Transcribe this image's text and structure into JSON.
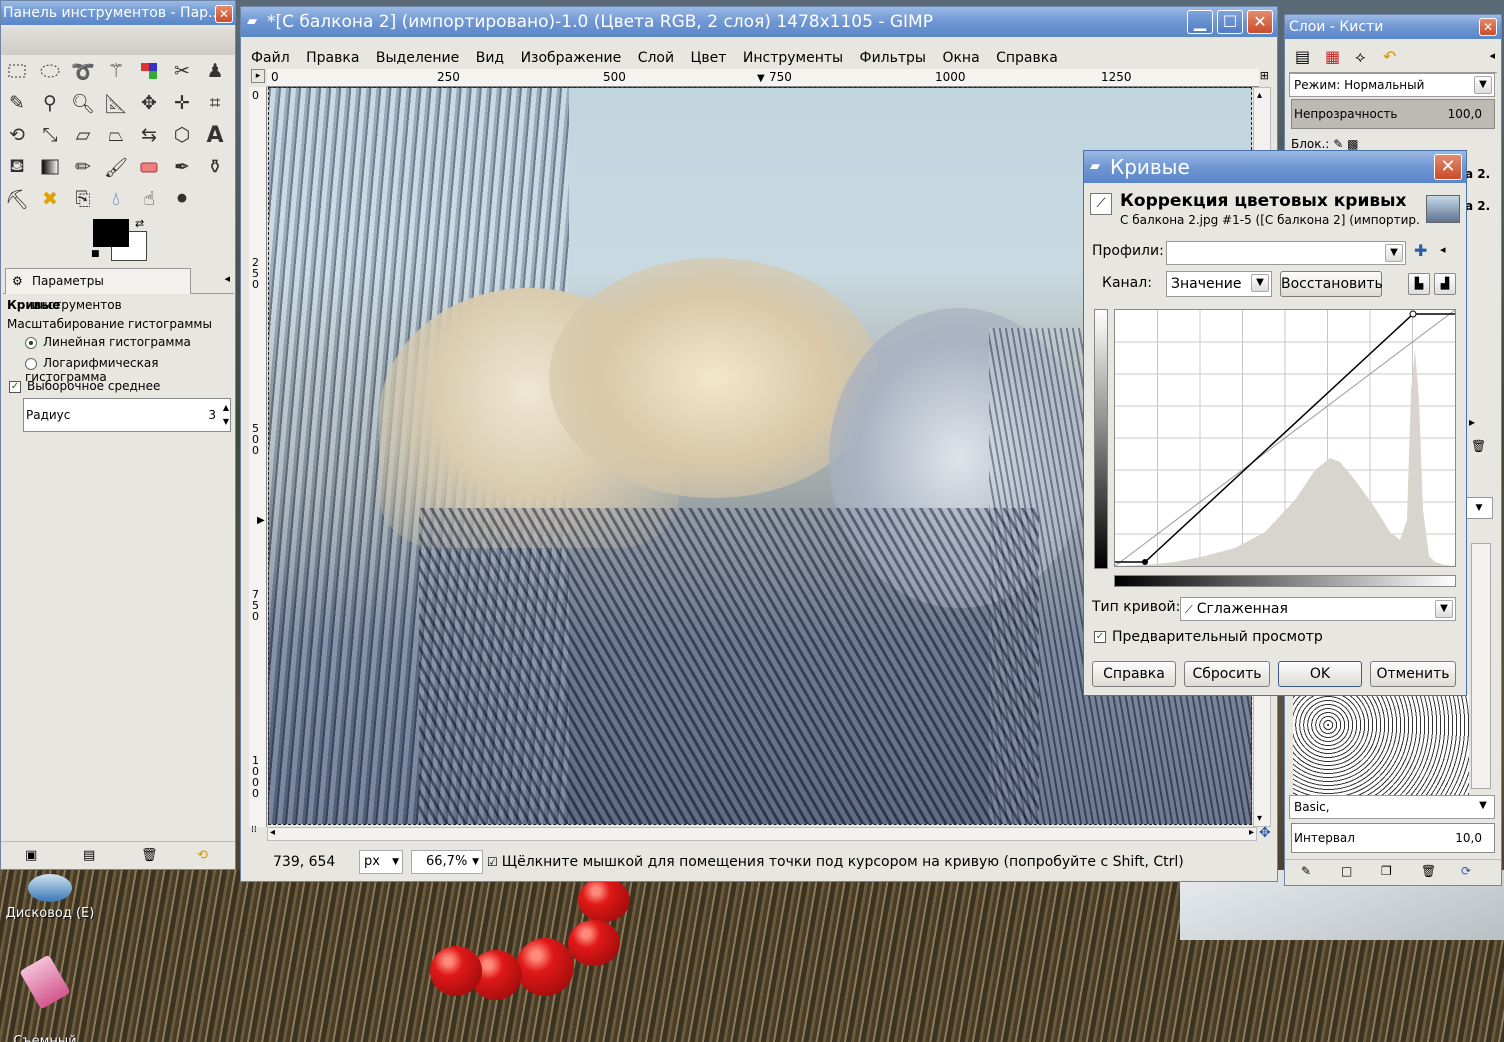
{
  "desktop": {
    "icons": [
      {
        "label": "Дисковод (E)"
      },
      {
        "label": "Съемный\nдиск (J)"
      }
    ]
  },
  "toolbox": {
    "title": "Панель инструментов - Пар...",
    "tool_options_tab": "Параметры инструментов",
    "section_title": "Кривые",
    "histogram_scale_label": "Масштабирование гистограммы",
    "linear_label": "Линейная гистограмма",
    "log_label": "Логарифмическая гистограмма",
    "sample_average_label": "Выборочное среднее",
    "radius_label": "Радиус",
    "radius_value": "3",
    "fg_color": "#000000",
    "bg_color": "#ffffff"
  },
  "image_window": {
    "title": "*[С балкона 2] (импортировано)-1.0 (Цвета RGB, 2 слоя) 1478x1105 - GIMP",
    "menu": [
      "Файл",
      "Правка",
      "Выделение",
      "Вид",
      "Изображение",
      "Слой",
      "Цвет",
      "Инструменты",
      "Фильтры",
      "Окна",
      "Справка"
    ],
    "ruler_h": [
      "0",
      "250",
      "500",
      "750",
      "1000",
      "1250"
    ],
    "ruler_v": [
      "0",
      "250",
      "500",
      "750",
      "1000"
    ],
    "coords": "739, 654",
    "unit": "px",
    "zoom": "66,7%",
    "status_text": "Щёлкните мышкой для помещения точки под курсором на кривую (попробуйте с Shift, Ctrl)"
  },
  "layers_dock": {
    "title": "Слои - Кисти",
    "mode_label": "Режим: Нормальный",
    "opacity_label": "Непрозрачность",
    "opacity_value": "100,0",
    "lock_label": "Блок.:",
    "layer_fragment_1": "а 2.",
    "layer_fragment_2": "а 2.",
    "brush_set": "Basic,",
    "spacing_label": "Интервал",
    "spacing_value": "10,0"
  },
  "curves": {
    "title": "Кривые",
    "header": "Коррекция цветовых кривых",
    "subheader": "С балкона 2.jpg #1-5 ([С балкона 2] (импортир...",
    "presets_label": "Профили:",
    "presets_value": "",
    "channel_label": "Канал:",
    "channel_value": "Значение",
    "reset_channel": "Восстановить",
    "curve_type_label": "Тип кривой:",
    "curve_type_value": "Сглаженная",
    "preview_label": "Предварительный просмотр",
    "buttons": {
      "help": "Справка",
      "reset": "Сбросить",
      "ok": "OK",
      "cancel": "Отменить"
    },
    "points": [
      [
        9,
        0
      ],
      [
        253,
        255
      ]
    ]
  }
}
